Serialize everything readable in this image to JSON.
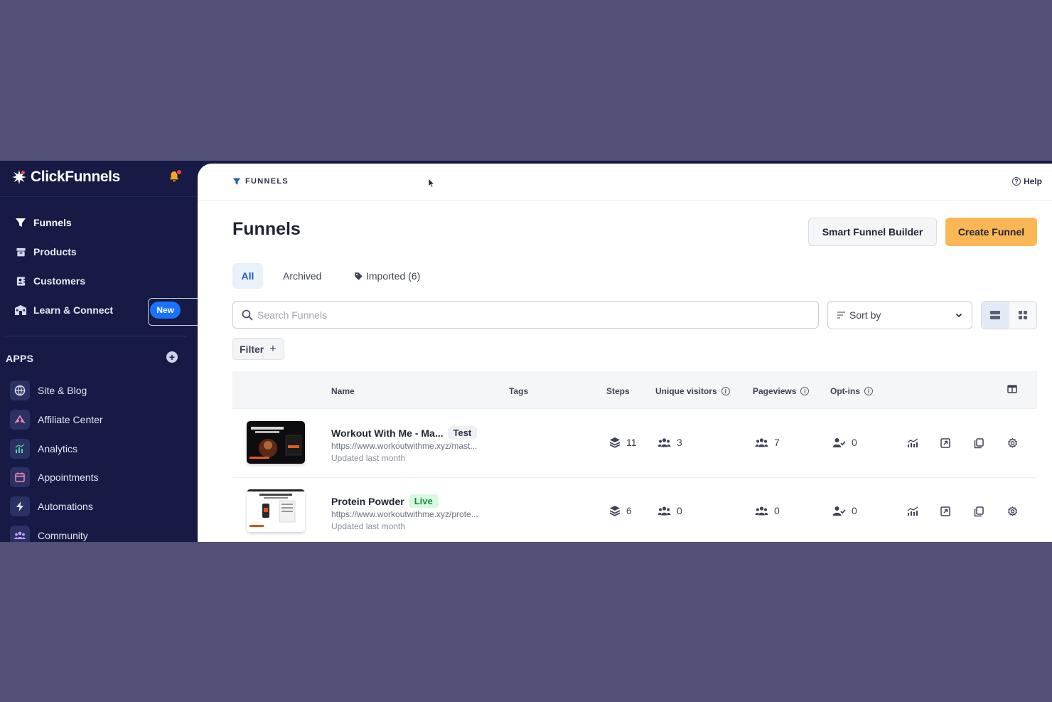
{
  "brand": {
    "name": "ClickFunnels"
  },
  "sidebar": {
    "nav": [
      {
        "label": "Funnels",
        "icon": "funnel-icon"
      },
      {
        "label": "Products",
        "icon": "box-icon"
      },
      {
        "label": "Customers",
        "icon": "contact-card-icon"
      },
      {
        "label": "Learn & Connect",
        "icon": "school-icon",
        "badge": "New"
      }
    ],
    "apps_label": "APPS",
    "apps": [
      {
        "label": "Site & Blog",
        "icon": "globe-icon"
      },
      {
        "label": "Affiliate Center",
        "icon": "affiliate-icon"
      },
      {
        "label": "Analytics",
        "icon": "analytics-icon"
      },
      {
        "label": "Appointments",
        "icon": "calendar-icon"
      },
      {
        "label": "Automations",
        "icon": "bolt-icon"
      },
      {
        "label": "Community",
        "icon": "community-icon"
      }
    ]
  },
  "topbar": {
    "breadcrumb": "FUNNELS",
    "help": "Help"
  },
  "page": {
    "title": "Funnels",
    "smart_builder_label": "Smart Funnel Builder",
    "create_label": "Create Funnel",
    "tabs": [
      {
        "label": "All"
      },
      {
        "label": "Archived"
      },
      {
        "label": "Imported (6)"
      }
    ],
    "search_placeholder": "Search Funnels",
    "sort_label": "Sort by",
    "filter_label": "Filter"
  },
  "table": {
    "columns": [
      "Name",
      "Tags",
      "Steps",
      "Unique visitors",
      "Pageviews",
      "Opt-ins"
    ],
    "rows": [
      {
        "name": "Workout With Me - Ma...",
        "status": "Test",
        "url": "https://www.workoutwithme.xyz/mast...",
        "updated": "Updated last month",
        "steps": "11",
        "unique_visitors": "3",
        "pageviews": "7",
        "optins": "0"
      },
      {
        "name": "Protein Powder",
        "status": "Live",
        "url": "https://www.workoutwithme.xyz/prote...",
        "updated": "Updated last month",
        "steps": "6",
        "unique_visitors": "0",
        "pageviews": "0",
        "optins": "0"
      }
    ]
  },
  "colors": {
    "sidebar_bg": "#161a44",
    "backdrop": "#525077",
    "primary_button": "#fbb755",
    "accent_blue": "#1d5fc0",
    "new_badge": "#1a73ff"
  }
}
